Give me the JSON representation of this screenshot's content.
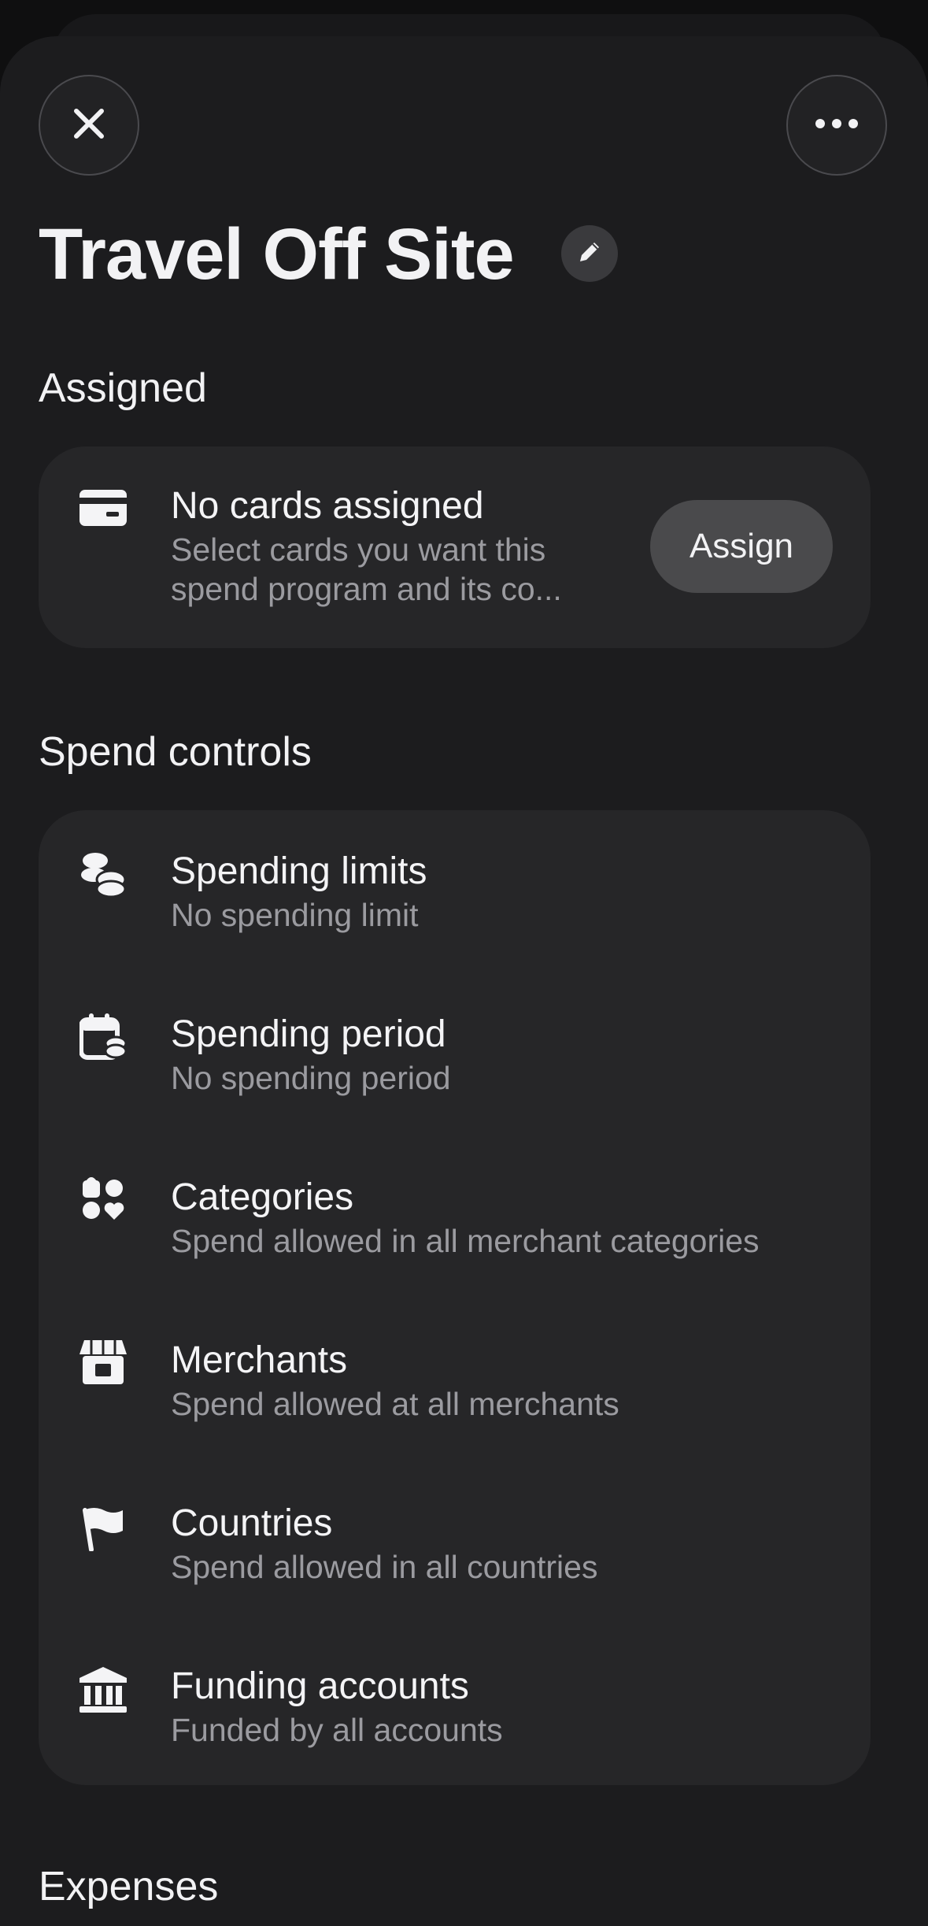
{
  "header": {
    "close_icon": "close-icon",
    "more_icon": "more-horizontal-icon",
    "title": "Travel Off Site",
    "edit_icon": "pencil-icon"
  },
  "assigned": {
    "section_title": "Assigned",
    "icon": "credit-card-icon",
    "title": "No cards assigned",
    "subtitle": "Select cards you want this spend program and its co...",
    "button_label": "Assign"
  },
  "spend_controls": {
    "section_title": "Spend controls",
    "items": [
      {
        "icon": "coins-icon",
        "title": "Spending limits",
        "subtitle": "No spending limit"
      },
      {
        "icon": "calendar-coins-icon",
        "title": "Spending period",
        "subtitle": "No spending period"
      },
      {
        "icon": "categories-icon",
        "title": "Categories",
        "subtitle": "Spend allowed in all merchant categories"
      },
      {
        "icon": "storefront-icon",
        "title": "Merchants",
        "subtitle": "Spend allowed at all merchants"
      },
      {
        "icon": "flag-icon",
        "title": "Countries",
        "subtitle": "Spend allowed in all countries"
      },
      {
        "icon": "bank-icon",
        "title": "Funding accounts",
        "subtitle": "Funded by all accounts"
      }
    ]
  },
  "expenses": {
    "section_title": "Expenses"
  }
}
